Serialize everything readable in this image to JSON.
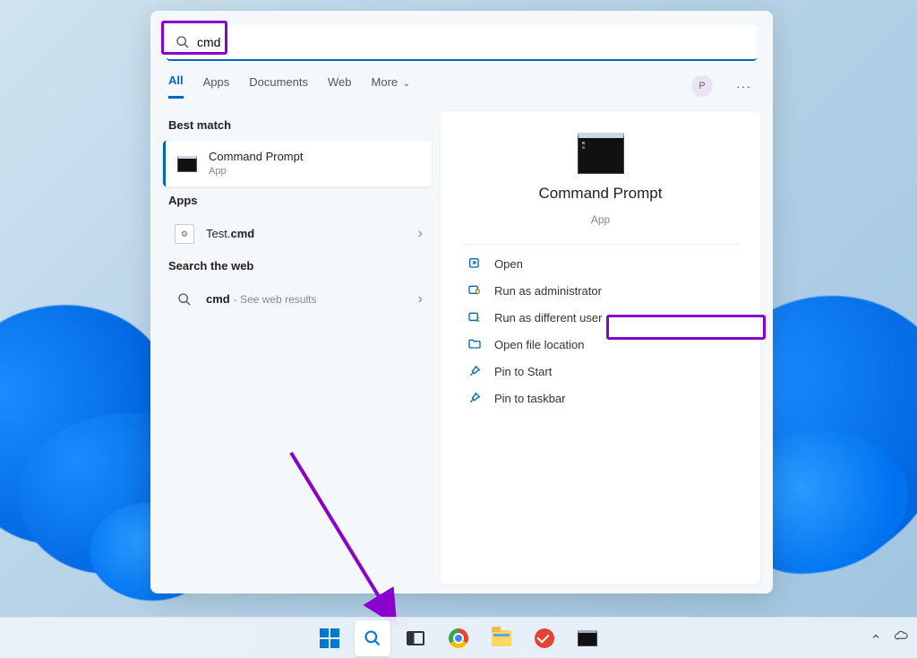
{
  "search": {
    "value": "cmd"
  },
  "tabs": {
    "items": [
      "All",
      "Apps",
      "Documents",
      "Web",
      "More"
    ],
    "avatar_initial": "P"
  },
  "left": {
    "best_match_heading": "Best match",
    "best_match": {
      "title": "Command Prompt",
      "subtitle": "App"
    },
    "apps_heading": "Apps",
    "apps": [
      {
        "title_prefix": "Test.",
        "title_bold": "cmd"
      }
    ],
    "web_heading": "Search the web",
    "web": {
      "query": "cmd",
      "hint": "- See web results"
    }
  },
  "preview": {
    "title": "Command Prompt",
    "subtitle": "App",
    "actions": {
      "open": "Open",
      "run_admin": "Run as administrator",
      "run_diff_user": "Run as different user",
      "open_location": "Open file location",
      "pin_start": "Pin to Start",
      "pin_taskbar": "Pin to taskbar"
    }
  }
}
